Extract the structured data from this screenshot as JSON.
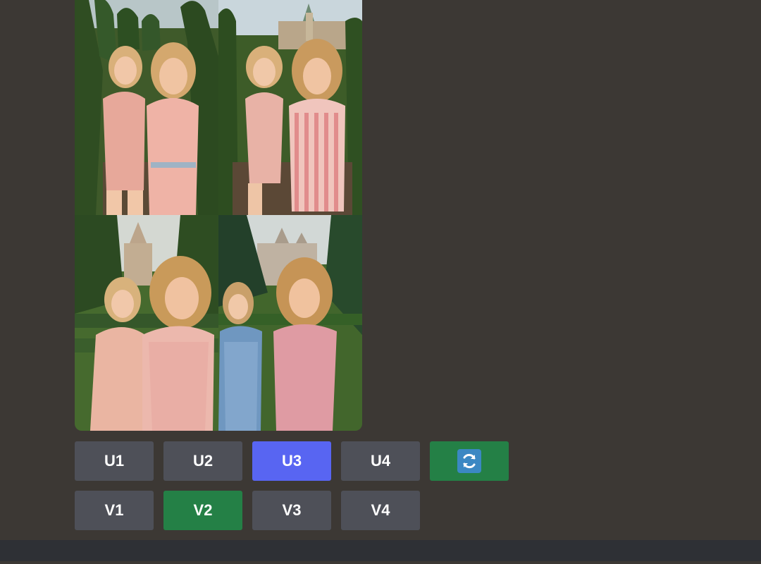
{
  "image_grid": {
    "tiles": [
      {
        "description": "two women in pink outfits laughing in a hedge maze"
      },
      {
        "description": "two women in pink striped rompers running through a hedge maze with a castle behind"
      },
      {
        "description": "two women in pink dresses laughing in a garden maze with a castle tower"
      },
      {
        "description": "two women, one in blue and one in pink, smiling in a hedge maze with a castle behind"
      }
    ]
  },
  "buttons": {
    "upscale": [
      {
        "label": "U1",
        "style": "gray"
      },
      {
        "label": "U2",
        "style": "gray"
      },
      {
        "label": "U3",
        "style": "blue"
      },
      {
        "label": "U4",
        "style": "gray"
      }
    ],
    "reroll": {
      "icon": "refresh-icon",
      "style": "green"
    },
    "variation": [
      {
        "label": "V1",
        "style": "gray"
      },
      {
        "label": "V2",
        "style": "green"
      },
      {
        "label": "V3",
        "style": "gray"
      },
      {
        "label": "V4",
        "style": "gray"
      }
    ]
  },
  "colors": {
    "background": "#3c3834",
    "button_gray": "#4e5058",
    "button_blue": "#5865f2",
    "button_green": "#248046",
    "bottom_bar": "#2e3035"
  }
}
